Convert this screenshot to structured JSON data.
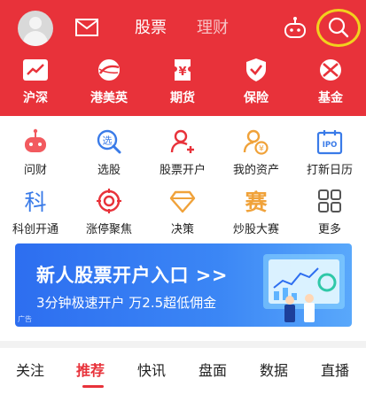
{
  "header": {
    "tabs": [
      {
        "label": "股票"
      },
      {
        "label": "理财"
      }
    ],
    "quick_items": [
      {
        "label": "沪深",
        "icon": "chart-trend-icon"
      },
      {
        "label": "港美英",
        "icon": "globe-icon"
      },
      {
        "label": "期货",
        "icon": "futures-ticket-icon"
      },
      {
        "label": "保险",
        "icon": "shield-check-icon"
      },
      {
        "label": "基金",
        "icon": "fund-ball-icon"
      }
    ],
    "colors": {
      "background": "#e8323a",
      "highlight_ring": "#f2d11e"
    }
  },
  "grid": {
    "items": [
      {
        "label": "问财",
        "icon": "robot-icon"
      },
      {
        "label": "选股",
        "icon": "stock-picker-icon"
      },
      {
        "label": "股票开户",
        "icon": "open-account-icon"
      },
      {
        "label": "我的资产",
        "icon": "assets-icon"
      },
      {
        "label": "打新日历",
        "icon": "ipo-calendar-icon"
      },
      {
        "label": "科创开通",
        "icon": "kechuang-icon"
      },
      {
        "label": "涨停聚焦",
        "icon": "target-icon"
      },
      {
        "label": "决策",
        "icon": "diamond-icon"
      },
      {
        "label": "炒股大赛",
        "icon": "contest-icon"
      },
      {
        "label": "更多",
        "icon": "more-grid-icon"
      }
    ],
    "icon_chars": {
      "kechuang": "科",
      "contest": "赛",
      "stock_picker": "选",
      "ipo": "IPO"
    }
  },
  "banner": {
    "title": "新人股票开户入口 >>",
    "subtitle": "3分钟极速开户  万2.5超低佣金",
    "ad_label": "广告"
  },
  "bottom_tabs": {
    "items": [
      {
        "label": "关注"
      },
      {
        "label": "推荐"
      },
      {
        "label": "快讯"
      },
      {
        "label": "盘面"
      },
      {
        "label": "数据"
      },
      {
        "label": "直播"
      }
    ],
    "active": "推荐"
  }
}
